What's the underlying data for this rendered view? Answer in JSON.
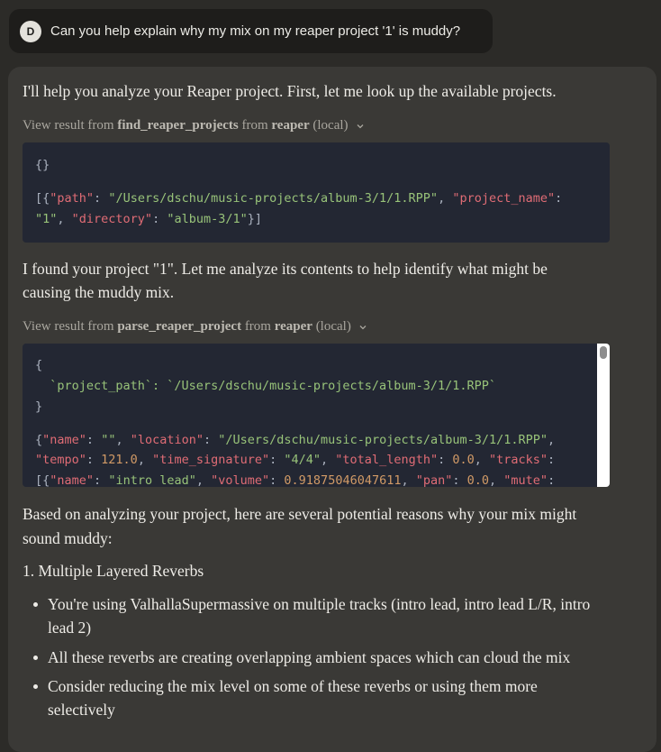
{
  "user_message": {
    "avatar_initial": "D",
    "text": "Can you help explain why my mix on my reaper project '1' is muddy?"
  },
  "assistant": {
    "intro": "I'll help you analyze your Reaper project. First, let me look up the available projects.",
    "tool1": {
      "prefix": "View result from",
      "tool_name": "find_reaper_projects",
      "from_word": "from",
      "server": "reaper",
      "scope": "(local)",
      "input": "{}",
      "output_line1": "[{\"path\": \"/Users/dschu/music-projects/album-3/1/1.RPP\", \"project_name\":",
      "output_line2": "\"1\", \"directory\": \"album-3/1\"}]"
    },
    "found_text": "I found your project \"1\". Let me analyze its contents to help identify what might be causing the muddy mix.",
    "found_line1": "I found your project \"1\". Let me analyze its contents to help identify what might be",
    "found_line2": "causing the muddy mix.",
    "tool2": {
      "prefix": "View result from",
      "tool_name": "parse_reaper_project",
      "from_word": "from",
      "server": "reaper",
      "scope": "(local)",
      "input_line1": "{",
      "input_line2": "  `project_path`: `/Users/dschu/music-projects/album-3/1/1.RPP`",
      "input_line3": "}",
      "output_line1": "{\"name\": \"\", \"location\": \"/Users/dschu/music-projects/album-3/1/1.RPP\",",
      "output_line2": "\"tempo\": 121.0, \"time_signature\": \"4/4\", \"total_length\": 0.0, \"tracks\":",
      "output_line3": "[{\"name\": \"intro lead\", \"volume\": 0.91875046047611, \"pan\": 0.0, \"mute\":"
    },
    "analysis_line1": "Based on analyzing your project, here are several potential reasons why your mix might",
    "analysis_line2": "sound muddy:",
    "list_item_1": "1. Multiple Layered Reverbs",
    "bullets": [
      {
        "line1": "You're using ValhallaSupermassive on multiple tracks (intro lead, intro lead L/R, intro",
        "line2": "lead 2)"
      },
      {
        "line1": "All these reverbs are creating overlapping ambient spaces which can cloud the mix",
        "line2": ""
      },
      {
        "line1": "Consider reducing the mix level on some of these reverbs or using them more",
        "line2": "selectively"
      }
    ]
  },
  "colors": {
    "background": "#2c2b28",
    "user_bubble": "#1e1d1b",
    "assistant_bubble": "#3a3936",
    "code_bg": "#232733",
    "json_key": "#e06c75",
    "json_string": "#98c379",
    "json_number": "#d19a66"
  },
  "icons": {
    "chevron": "chevron-down-icon"
  }
}
